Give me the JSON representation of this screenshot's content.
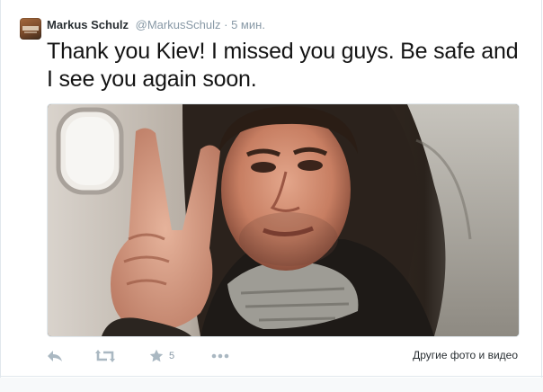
{
  "tweet": {
    "author_name": "Markus Schulz",
    "author_handle": "@MarkusSchulz",
    "separator": "·",
    "timestamp": "5 мин.",
    "text": "Thank you Kiev! I missed you guys. Be safe and I see you again soon.",
    "favorite_count": "5",
    "media_link_label": "Другие фото и видео"
  },
  "icons": {
    "reply": "reply-icon",
    "retweet": "retweet-icon",
    "favorite": "star-icon",
    "more": "more-icon"
  },
  "colors": {
    "text": "#141414",
    "muted": "#8899a6",
    "action": "#aab8c2",
    "border": "#e1e8ed"
  }
}
